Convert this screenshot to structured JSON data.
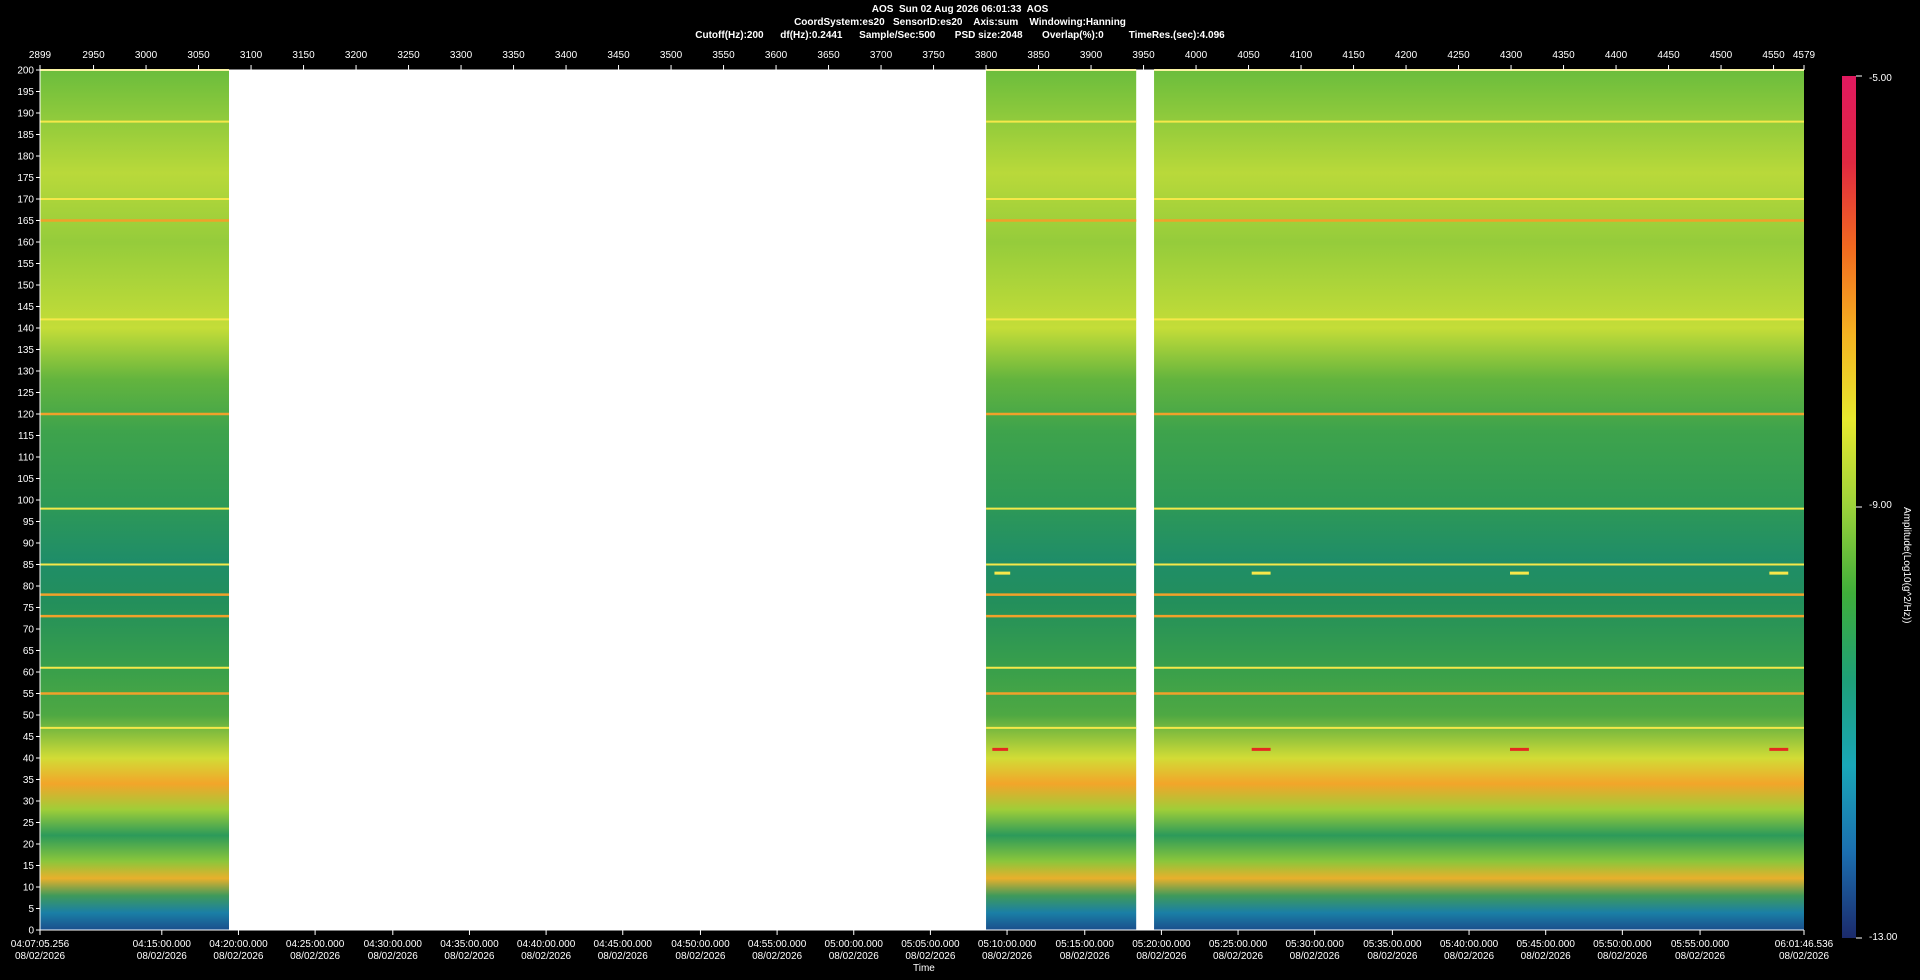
{
  "header": {
    "line1": "AOS  Sun 02 Aug 2026 06:01:33  AOS",
    "line2": "CoordSystem:es20   SensorID:es20    Axis:sum    Windowing:Hanning",
    "line3": "Cutoff(Hz):200      df(Hz):0.2441      Sample/Sec:500       PSD size:2048       Overlap(%):0         TimeRes.(sec):4.096"
  },
  "chart_data": {
    "type": "heatmap",
    "title": "AOS  Sun 02 Aug 2026 06:01:33  AOS",
    "xlabel": "Time",
    "ylabel": "",
    "ylim": [
      0,
      200
    ],
    "y_ticks": [
      0,
      5,
      10,
      15,
      20,
      25,
      30,
      35,
      40,
      45,
      50,
      55,
      60,
      65,
      70,
      75,
      80,
      85,
      90,
      95,
      100,
      105,
      110,
      115,
      120,
      125,
      130,
      135,
      140,
      145,
      150,
      155,
      160,
      165,
      170,
      175,
      180,
      185,
      190,
      195,
      200
    ],
    "top_axis": {
      "range": [
        2899,
        4579
      ],
      "ticks": [
        2899,
        2950,
        3000,
        3050,
        3100,
        3150,
        3200,
        3250,
        3300,
        3350,
        3400,
        3450,
        3500,
        3550,
        3600,
        3650,
        3700,
        3750,
        3800,
        3850,
        3900,
        3950,
        4000,
        4050,
        4100,
        4150,
        4200,
        4250,
        4300,
        4350,
        4400,
        4450,
        4500,
        4550,
        4579
      ]
    },
    "bottom_axis": {
      "ticks": [
        {
          "time": "04:07:05.256",
          "date": "08/02/2026",
          "index": 2899
        },
        {
          "time": "04:15:00.000",
          "date": "08/02/2026",
          "index": 3015
        },
        {
          "time": "04:20:00.000",
          "date": "08/02/2026",
          "index": 3088
        },
        {
          "time": "04:25:00.000",
          "date": "08/02/2026",
          "index": 3161
        },
        {
          "time": "04:30:00.000",
          "date": "08/02/2026",
          "index": 3235
        },
        {
          "time": "04:35:00.000",
          "date": "08/02/2026",
          "index": 3308
        },
        {
          "time": "04:40:00.000",
          "date": "08/02/2026",
          "index": 3381
        },
        {
          "time": "04:45:00.000",
          "date": "08/02/2026",
          "index": 3454
        },
        {
          "time": "04:50:00.000",
          "date": "08/02/2026",
          "index": 3528
        },
        {
          "time": "04:55:00.000",
          "date": "08/02/2026",
          "index": 3601
        },
        {
          "time": "05:00:00.000",
          "date": "08/02/2026",
          "index": 3674
        },
        {
          "time": "05:05:00.000",
          "date": "08/02/2026",
          "index": 3747
        },
        {
          "time": "05:10:00.000",
          "date": "08/02/2026",
          "index": 3820
        },
        {
          "time": "05:15:00.000",
          "date": "08/02/2026",
          "index": 3894
        },
        {
          "time": "05:20:00.000",
          "date": "08/02/2026",
          "index": 3967
        },
        {
          "time": "05:25:00.000",
          "date": "08/02/2026",
          "index": 4040
        },
        {
          "time": "05:30:00.000",
          "date": "08/02/2026",
          "index": 4113
        },
        {
          "time": "05:35:00.000",
          "date": "08/02/2026",
          "index": 4187
        },
        {
          "time": "05:40:00.000",
          "date": "08/02/2026",
          "index": 4260
        },
        {
          "time": "05:45:00.000",
          "date": "08/02/2026",
          "index": 4333
        },
        {
          "time": "05:50:00.000",
          "date": "08/02/2026",
          "index": 4406
        },
        {
          "time": "05:55:00.000",
          "date": "08/02/2026",
          "index": 4480
        },
        {
          "time": "06:01:46.536",
          "date": "08/02/2026",
          "index": 4579
        }
      ]
    },
    "data_segments": [
      [
        2899,
        3079
      ],
      [
        3800,
        3943
      ],
      [
        3960,
        4579
      ]
    ],
    "gap_segments": [
      [
        3079,
        3800
      ],
      [
        3943,
        3960
      ]
    ],
    "horizontal_lines": [
      {
        "freq": 200,
        "level": "yellow"
      },
      {
        "freq": 188,
        "level": "yellow"
      },
      {
        "freq": 170,
        "level": "yellow"
      },
      {
        "freq": 165,
        "level": "orange"
      },
      {
        "freq": 142,
        "level": "yellow"
      },
      {
        "freq": 120,
        "level": "orange"
      },
      {
        "freq": 98,
        "level": "yellow"
      },
      {
        "freq": 85,
        "level": "yellow"
      },
      {
        "freq": 78,
        "level": "orange"
      },
      {
        "freq": 73,
        "level": "orange"
      },
      {
        "freq": 61,
        "level": "yellow"
      },
      {
        "freq": 55,
        "level": "orange"
      },
      {
        "freq": 47,
        "level": "yellow"
      }
    ],
    "short_marks": [
      {
        "x0": 3808,
        "x1": 3823,
        "freq": 83,
        "color": "#f7e84a"
      },
      {
        "x0": 4053,
        "x1": 4071,
        "freq": 83,
        "color": "#f7e84a"
      },
      {
        "x0": 4299,
        "x1": 4317,
        "freq": 83,
        "color": "#f7e84a"
      },
      {
        "x0": 4546,
        "x1": 4564,
        "freq": 83,
        "color": "#f7e84a"
      },
      {
        "x0": 3806,
        "x1": 3821,
        "freq": 42,
        "color": "#e42a1f"
      },
      {
        "x0": 4053,
        "x1": 4071,
        "freq": 42,
        "color": "#e42a1f"
      },
      {
        "x0": 4299,
        "x1": 4317,
        "freq": 42,
        "color": "#e42a1f"
      },
      {
        "x0": 4546,
        "x1": 4564,
        "freq": 42,
        "color": "#e42a1f"
      }
    ],
    "colorbar": {
      "label": "Amplitude(Log10(g^2/Hz))",
      "min": -13.0,
      "mid": -9.0,
      "max": -5.0,
      "min_label": "-13.00",
      "mid_label": "-9.00",
      "max_label": "-5.00",
      "colors": [
        "#1b2a6b",
        "#1b6fb0",
        "#19a6b8",
        "#1ea078",
        "#3fae3a",
        "#9bd23a",
        "#e7e92e",
        "#f5b321",
        "#f26a1f",
        "#e02841",
        "#e0195f"
      ]
    },
    "grid": false
  }
}
